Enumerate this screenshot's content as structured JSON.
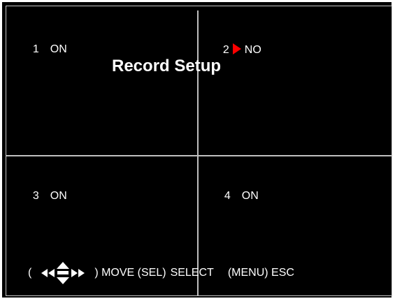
{
  "menu": {
    "title": "Record Setup",
    "cursor_color": "#ff0000"
  },
  "channels": [
    {
      "num": "1",
      "status": "ON"
    },
    {
      "num": "2",
      "status": "NO"
    },
    {
      "num": "3",
      "status": "ON"
    },
    {
      "num": "4",
      "status": "ON"
    }
  ],
  "help": {
    "open_paren": "(",
    "nav_icon": "direction-arrows-icon",
    "move": ") MOVE (SEL)",
    "select": "SELECT",
    "esc": "(MENU) ESC"
  }
}
